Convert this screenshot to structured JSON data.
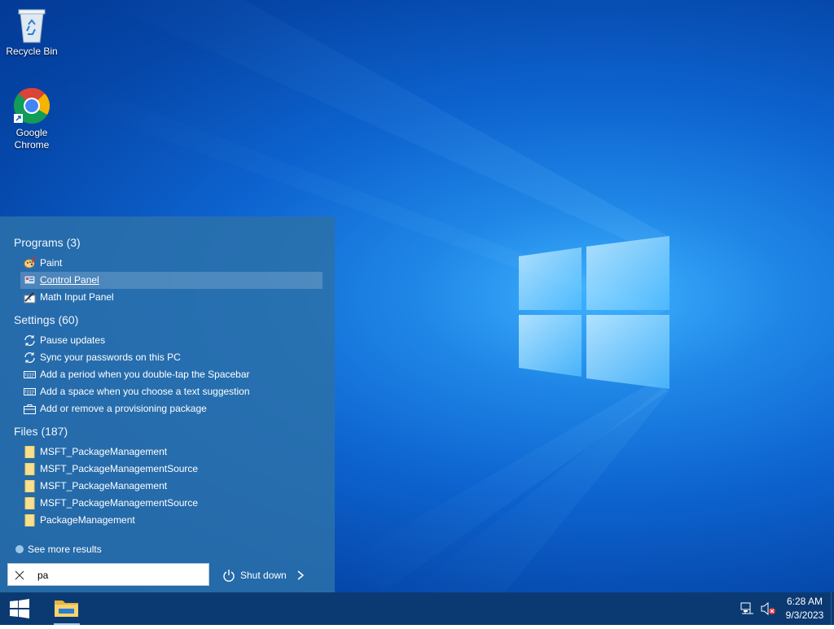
{
  "desktop": {
    "icons": [
      {
        "label": "Recycle Bin",
        "icon": "recycle-bin-icon"
      },
      {
        "label": "Google Chrome",
        "icon": "chrome-icon"
      }
    ]
  },
  "start_menu": {
    "sections": [
      {
        "title": "Programs (3)",
        "items": [
          {
            "label": "Paint",
            "icon": "paint-icon"
          },
          {
            "label": "Control Panel",
            "icon": "control-panel-icon",
            "selected": true
          },
          {
            "label": "Math Input Panel",
            "icon": "math-input-icon"
          }
        ]
      },
      {
        "title": "Settings (60)",
        "items": [
          {
            "label": "Pause updates",
            "icon": "sync-icon"
          },
          {
            "label": "Sync your passwords on this PC",
            "icon": "sync-icon"
          },
          {
            "label": "Add a period when you double-tap the Spacebar",
            "icon": "keyboard-icon"
          },
          {
            "label": "Add a space when you choose a text suggestion",
            "icon": "keyboard-icon"
          },
          {
            "label": "Add or remove a provisioning package",
            "icon": "briefcase-icon"
          }
        ]
      },
      {
        "title": "Files (187)",
        "items": [
          {
            "label": "MSFT_PackageManagement",
            "icon": "file-icon"
          },
          {
            "label": "MSFT_PackageManagementSource",
            "icon": "file-icon"
          },
          {
            "label": "MSFT_PackageManagement",
            "icon": "file-icon"
          },
          {
            "label": "MSFT_PackageManagementSource",
            "icon": "file-icon"
          },
          {
            "label": "PackageManagement",
            "icon": "file-icon"
          }
        ]
      }
    ],
    "see_more": "See more results",
    "search": {
      "value": "pa"
    },
    "shutdown_label": "Shut down"
  },
  "taskbar": {
    "clock_time": "6:28 AM",
    "clock_date": "9/3/2023"
  },
  "colors": {
    "start_menu_bg": "#2b71aa",
    "taskbar_bg": "#0b3a73",
    "desktop_blue": "#0d63cf"
  }
}
